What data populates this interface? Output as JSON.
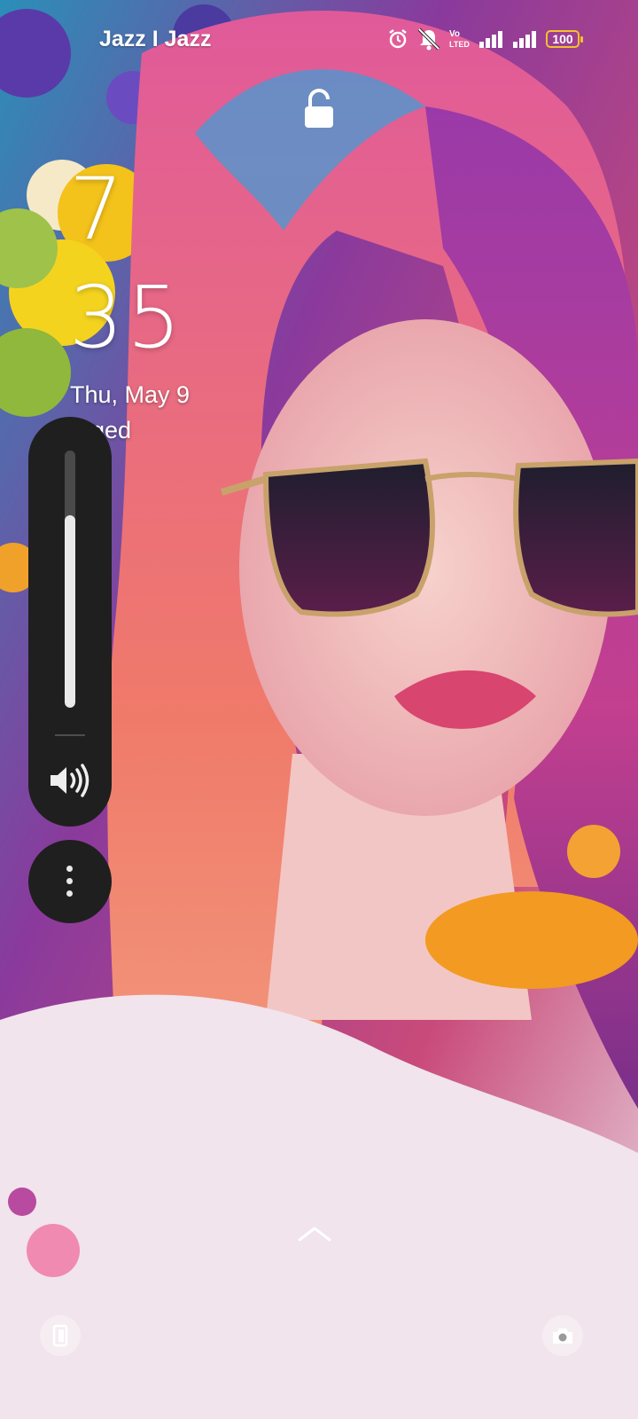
{
  "status_bar": {
    "carrier": "Jazz I Jazz",
    "volte_label_top": "Vo",
    "volte_label_bottom": "LTED",
    "battery_level": "100",
    "icons": [
      "alarm-icon",
      "notifications-off-icon",
      "volte-icon",
      "signal-sim1-icon",
      "signal-sim2-icon",
      "battery-icon"
    ]
  },
  "lock_screen": {
    "lock_icon": "unlocked-padlock-icon",
    "clock_hour": "7",
    "clock_minute": "35",
    "date": "Thu, May 9",
    "charging_status": "arged"
  },
  "volume_panel": {
    "level_fraction": 0.75,
    "speaker_icon": "speaker-icon",
    "more_icon": "more-vertical-icon"
  },
  "bottom": {
    "swipe_icon": "chevron-up-icon",
    "left_shortcut_icon": "phone-icon",
    "right_shortcut_icon": "camera-icon"
  },
  "colors": {
    "battery_outline": "#f2c12e",
    "panel_background": "#1f1f1f"
  }
}
